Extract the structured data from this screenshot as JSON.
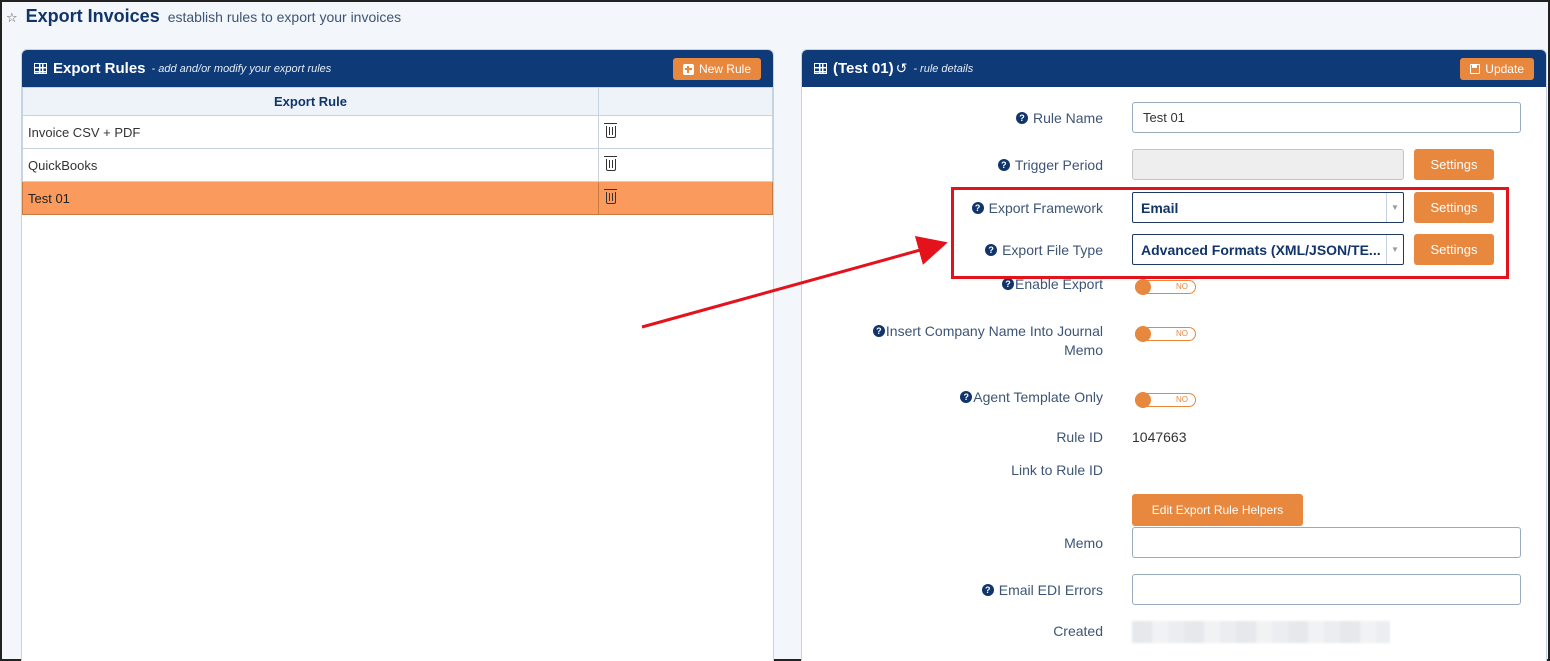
{
  "page": {
    "title": "Export Invoices",
    "subtitle": "establish rules to export your invoices"
  },
  "left_panel": {
    "title": "Export Rules",
    "subtitle": "- add and/or modify your export rules",
    "new_rule_label": "New Rule",
    "column_header": "Export Rule",
    "rows": [
      {
        "name": "Invoice CSV + PDF"
      },
      {
        "name": "QuickBooks"
      },
      {
        "name": "Test 01",
        "selected": true
      }
    ]
  },
  "right_panel": {
    "title": "(Test 01)",
    "subtitle": "- rule details",
    "update_label": "Update",
    "fields": {
      "rule_name_label": "Rule Name",
      "rule_name_value": "Test 01",
      "trigger_period_label": "Trigger Period",
      "export_framework_label": "Export Framework",
      "export_framework_value": "Email",
      "export_file_type_label": "Export File Type",
      "export_file_type_value": "Advanced Formats (XML/JSON/TE...",
      "settings_label": "Settings",
      "enable_export_label": "Enable Export",
      "insert_company_label_1": "Insert Company Name Into Journal",
      "insert_company_label_2": "Memo",
      "agent_template_label": "Agent Template Only",
      "toggle_off_label": "NO",
      "rule_id_label": "Rule ID",
      "rule_id_value": "1047663",
      "link_rule_id_label": "Link to Rule ID",
      "edit_helpers_label": "Edit Export Rule Helpers",
      "memo_label": "Memo",
      "email_edi_label": "Email EDI Errors",
      "created_label": "Created"
    }
  },
  "colors": {
    "header_blue": "#0f3a78",
    "accent_orange": "#e8873e",
    "selected_row": "#fa9b5d",
    "annotation_red": "#e3121b"
  }
}
